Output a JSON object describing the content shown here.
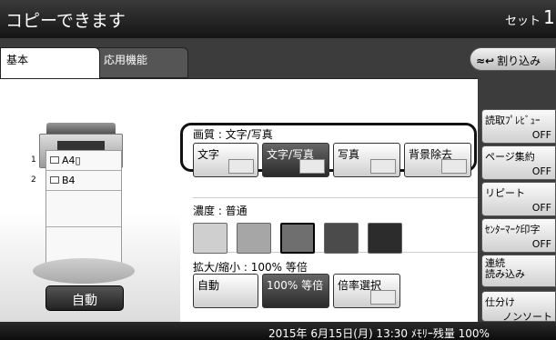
{
  "header": {
    "status": "コピーできます",
    "set_label": "セット",
    "set_count": "1"
  },
  "tabs": {
    "basic": "基本",
    "advanced": "応用機能"
  },
  "interrupt": {
    "icon": "≈↩",
    "label": "割り込み"
  },
  "trays": [
    {
      "no": "1",
      "label": "A4▯"
    },
    {
      "no": "2",
      "label": "B4"
    }
  ],
  "auto_label": "自動",
  "quality": {
    "label": "画質 : 文字/写真",
    "options": [
      "文字",
      "文字/写真",
      "写真",
      "背景除去"
    ],
    "selected": "文字/写真"
  },
  "density": {
    "label": "濃度 : 普通",
    "levels": [
      "#cfcfcf",
      "#a6a6a6",
      "#6f6f6f",
      "#4b4b4b",
      "#2c2c2c"
    ],
    "selected_index": 2
  },
  "zoom": {
    "label": "拡大/縮小 : 100% 等倍",
    "options": [
      "自動",
      "100% 等倍",
      "倍率選択"
    ],
    "selected": "100% 等倍"
  },
  "side": [
    {
      "label": "読取ﾌﾟﾚﾋﾞｭｰ",
      "value": "OFF"
    },
    {
      "label": "ページ集約",
      "value": "OFF"
    },
    {
      "label": "リピート",
      "value": "OFF"
    },
    {
      "label": "ｾﾝﾀｰﾏｰｸ印字",
      "value": "OFF"
    },
    {
      "label": "連続\n読み込み",
      "value": ""
    },
    {
      "label": "仕分け",
      "value": ""
    },
    {
      "label": "ノンソート",
      "value": ""
    }
  ],
  "footer": "2015年 6月15日(月) 13:30 ﾒﾓﾘｰ残量 100%",
  "colors": {
    "selected": "#333333",
    "highlight": "#111111"
  }
}
